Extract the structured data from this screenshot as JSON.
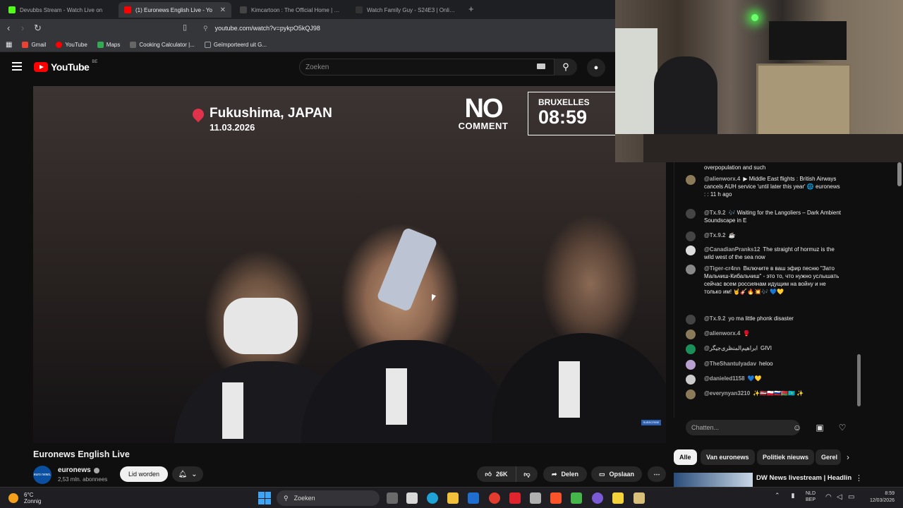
{
  "browser": {
    "tabs": [
      {
        "title": "Devubbs Stream - Watch Live on",
        "color": "#53fc18",
        "active": false
      },
      {
        "title": "(1) Euronews English Live - Yo",
        "color": "#ff0000",
        "active": true
      },
      {
        "title": "Kimcartoon : The Official Home | kim",
        "color": "#444444",
        "active": false
      },
      {
        "title": "Watch Family Guy - S24E3 | Online H",
        "color": "#333333",
        "active": false
      }
    ],
    "new_tab": "+",
    "url": "youtube.com/watch?v=pykpO5kQJ98",
    "bookmarks": [
      {
        "label": "Gmail",
        "color": "#ea4335"
      },
      {
        "label": "YouTube",
        "color": "#ff0000"
      },
      {
        "label": "Maps",
        "color": "#34a853"
      },
      {
        "label": "Cooking Calculator |...",
        "color": "#666666"
      },
      {
        "label": "Geïmporteerd uit G...",
        "color": "#9aa0a6"
      }
    ]
  },
  "youtube": {
    "logo_text": "YouTube",
    "country": "BE",
    "search_placeholder": "Zoeken"
  },
  "video": {
    "location_city": "Fukushima, JAPAN",
    "location_date": "11.03.2026",
    "brand_no": "NO",
    "brand_comment": "COMMENT",
    "clock_city": "BRUXELLES",
    "clock_time": "08:59",
    "subscribe_mini": "SUBSCRIBE",
    "title": "Euronews English Live"
  },
  "channel": {
    "avatar_text": "euro news.",
    "name": "euronews",
    "subscribers": "2,53 mln. abonnees",
    "join_label": "Lid worden"
  },
  "actions": {
    "likes": "26K",
    "share_label": "Delen",
    "save_label": "Opslaan"
  },
  "chat": {
    "messages": [
      {
        "author": "",
        "text": "overpopulation and such",
        "color": "#666"
      },
      {
        "author": "@alienworx.4",
        "text": "▶ Middle East flights : British Airways cancels AUH service 'until later this year' 🌐 euronews : : 11 h ago",
        "color": "#8a7a5a"
      },
      {
        "author": "@Tx.9.2",
        "text": "🎶 Waiting for the Langoliers – Dark Ambient Soundscape in E",
        "color": "#444"
      },
      {
        "author": "@Tx.9.2",
        "text": "☕",
        "color": "#444"
      },
      {
        "author": "@CanadianPranks12",
        "text": "The straight of hormuz is the wild west of the sea now",
        "color": "#ddd"
      },
      {
        "author": "@Tiger-cr4nn",
        "text": "Включите в ваш эфир песню \"Зато Мальчиш-Кибальчиш\" - это то, что нужно услышать сейчас всем россиянам идущим на войну и не только им! 🤘🎸🔥💥🎶 💙💛",
        "color": "#888"
      },
      {
        "author": "@Tx.9.2",
        "text": "yo ma little phonk disaster",
        "color": "#444"
      },
      {
        "author": "@alienworx.4",
        "text": "🥊",
        "color": "#8a7a5a"
      },
      {
        "author": "@ابراهیم‌المنظری‌جیگر",
        "text": "GIVI",
        "color": "#1a8f5a"
      },
      {
        "author": "@TheShantulyadav",
        "text": "heloo",
        "color": "#b8a0d0"
      },
      {
        "author": "@danieled1158",
        "text": "💙💛",
        "color": "#ccc"
      },
      {
        "author": "@everynyan3210",
        "text": "✨🇱🇻🇵🇱🇷🇺🇧🇾🇰🇿 ✨",
        "color": "#8a7a5a"
      }
    ],
    "input_placeholder": "Chatten..."
  },
  "chips": [
    "Alle",
    "Van euronews",
    "Politiek nieuws",
    "Gerel"
  ],
  "related": {
    "title": "DW News livestream | Headline"
  },
  "taskbar": {
    "temperature": "6°C",
    "weather": "Zonnig",
    "search_label": "Zoeken",
    "lang_line1": "NLD",
    "lang_line2": "BEP",
    "time": "8:59",
    "date": "12/03/2026"
  }
}
